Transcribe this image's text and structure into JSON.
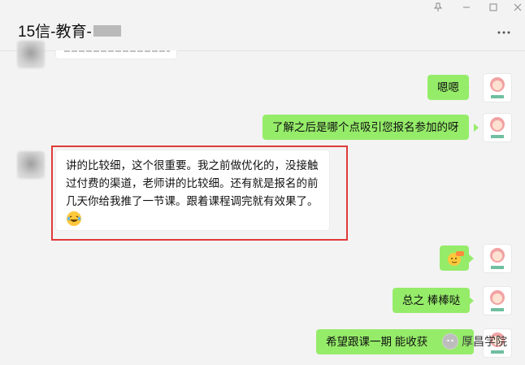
{
  "window": {
    "title": "15信-教育-",
    "pin_icon": "pin-icon",
    "minimize_icon": "minimize-icon",
    "maximize_icon": "maximize-icon",
    "close_icon": "close-icon",
    "more_icon": "more-options-icon"
  },
  "messages": [
    {
      "side": "right",
      "text": "嗯嗯"
    },
    {
      "side": "right",
      "text": "了解之后是哪个点吸引您报名参加的呀"
    },
    {
      "side": "left",
      "lines": [
        "讲的比较细，这个很重要。我之前做优化的，没接触",
        "过付费的渠道，老师讲的比较细。还有就是报名的前",
        "几天你给我推了一节课。跟着课程调完就有效果了。"
      ],
      "emoji": "laughing-tears-emoji"
    },
    {
      "side": "right",
      "emoji": "666-emoji"
    },
    {
      "side": "right",
      "text": "总之 棒棒哒"
    },
    {
      "side": "right",
      "text": "希望跟课一期 能收获"
    }
  ],
  "watermark": {
    "text": "厚昌学院"
  },
  "colors": {
    "bubble_green": "#95ec69",
    "highlight_red": "#e03a3a",
    "background": "#f3f3f3"
  }
}
